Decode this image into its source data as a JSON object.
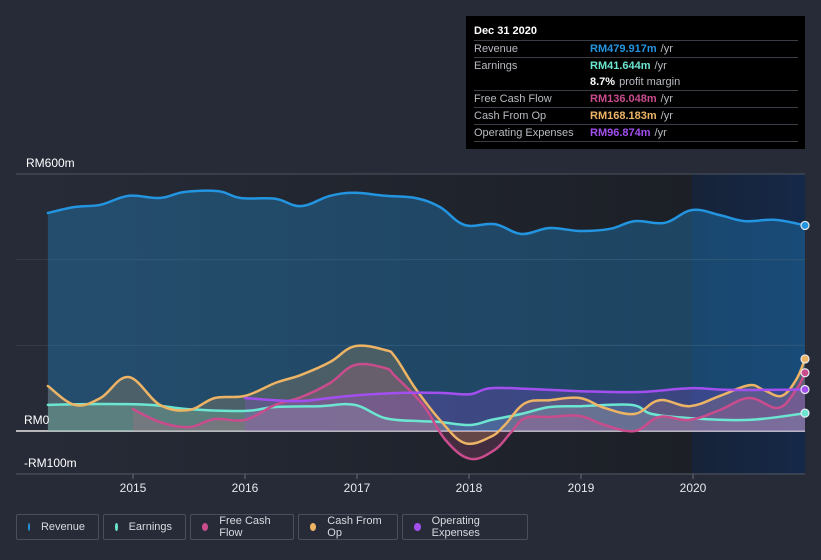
{
  "tooltip": {
    "date": "Dec 31 2020",
    "rows": [
      {
        "label": "Revenue",
        "value": "RM479.917m",
        "unit": "/yr",
        "color": "#2394df"
      },
      {
        "label": "Earnings",
        "value": "RM41.644m",
        "unit": "/yr",
        "color": "#6ce5d1"
      },
      {
        "label": "",
        "value": "8.7%",
        "unit": "profit margin",
        "color": "#ffffff"
      },
      {
        "label": "Free Cash Flow",
        "value": "RM136.048m",
        "unit": "/yr",
        "color": "#c94c8d"
      },
      {
        "label": "Cash From Op",
        "value": "RM168.183m",
        "unit": "/yr",
        "color": "#eeb465"
      },
      {
        "label": "Operating Expenses",
        "value": "RM96.874m",
        "unit": "/yr",
        "color": "#a34ff0"
      }
    ]
  },
  "legend": [
    {
      "label": "Revenue",
      "color": "#2394df"
    },
    {
      "label": "Earnings",
      "color": "#6ce5d1"
    },
    {
      "label": "Free Cash Flow",
      "color": "#c94c8d"
    },
    {
      "label": "Cash From Op",
      "color": "#eeb465"
    },
    {
      "label": "Operating Expenses",
      "color": "#a34ff0"
    }
  ],
  "chart_data": {
    "type": "area",
    "title": "",
    "xlabel": "",
    "ylabel": "",
    "ylim": [
      -100,
      600
    ],
    "xlim": [
      2014.24,
      2021.0
    ],
    "y_tick_labels": [
      {
        "value": 600,
        "label": "RM600m"
      },
      {
        "value": 0,
        "label": "RM0"
      },
      {
        "value": -100,
        "label": "-RM100m"
      }
    ],
    "y_gridlines": [
      600,
      400,
      200,
      0,
      -100
    ],
    "x_tick_labels": [
      {
        "value": 2015,
        "label": "2015"
      },
      {
        "value": 2016,
        "label": "2016"
      },
      {
        "value": 2017,
        "label": "2017"
      },
      {
        "value": 2018,
        "label": "2018"
      },
      {
        "value": 2019,
        "label": "2019"
      },
      {
        "value": 2020,
        "label": "2020"
      }
    ],
    "highlight_range": [
      2020.0,
      2021.0
    ],
    "legend_position": "bottom-left",
    "grid": true,
    "series": [
      {
        "name": "Revenue",
        "color": "#2394df",
        "points": [
          [
            2014.24,
            509
          ],
          [
            2014.48,
            523
          ],
          [
            2014.71,
            528
          ],
          [
            2014.96,
            549
          ],
          [
            2015.24,
            544
          ],
          [
            2015.46,
            558
          ],
          [
            2015.76,
            560
          ],
          [
            2015.96,
            544
          ],
          [
            2016.27,
            542
          ],
          [
            2016.5,
            525
          ],
          [
            2016.76,
            549
          ],
          [
            2016.98,
            556
          ],
          [
            2017.25,
            549
          ],
          [
            2017.52,
            544
          ],
          [
            2017.74,
            523
          ],
          [
            2017.96,
            481
          ],
          [
            2018.23,
            483
          ],
          [
            2018.47,
            460
          ],
          [
            2018.72,
            474
          ],
          [
            2018.99,
            467
          ],
          [
            2019.26,
            472
          ],
          [
            2019.48,
            490
          ],
          [
            2019.75,
            486
          ],
          [
            2019.99,
            516
          ],
          [
            2020.24,
            504
          ],
          [
            2020.46,
            490
          ],
          [
            2020.73,
            493
          ],
          [
            2021.0,
            479.917
          ]
        ]
      },
      {
        "name": "Earnings",
        "color": "#6ce5d1",
        "points": [
          [
            2014.24,
            61
          ],
          [
            2014.71,
            63
          ],
          [
            2015.15,
            61
          ],
          [
            2015.5,
            51
          ],
          [
            2016.0,
            47
          ],
          [
            2016.27,
            56
          ],
          [
            2016.67,
            58
          ],
          [
            2016.98,
            61
          ],
          [
            2017.25,
            30
          ],
          [
            2017.56,
            23
          ],
          [
            2017.74,
            21
          ],
          [
            2018.01,
            14
          ],
          [
            2018.2,
            26
          ],
          [
            2018.47,
            40
          ],
          [
            2018.72,
            56
          ],
          [
            2019.0,
            58
          ],
          [
            2019.45,
            61
          ],
          [
            2019.63,
            40
          ],
          [
            2019.97,
            30
          ],
          [
            2020.5,
            26
          ],
          [
            2021.0,
            41.644
          ]
        ]
      },
      {
        "name": "Free Cash Flow",
        "color": "#c94c8d",
        "points": [
          [
            2015.0,
            51
          ],
          [
            2015.24,
            21
          ],
          [
            2015.5,
            9
          ],
          [
            2015.73,
            28
          ],
          [
            2016.0,
            26
          ],
          [
            2016.27,
            61
          ],
          [
            2016.5,
            79
          ],
          [
            2016.76,
            112
          ],
          [
            2016.98,
            154
          ],
          [
            2017.25,
            147
          ],
          [
            2017.34,
            128
          ],
          [
            2017.59,
            61
          ],
          [
            2017.79,
            -21
          ],
          [
            2018.01,
            -65
          ],
          [
            2018.23,
            -44
          ],
          [
            2018.37,
            -5
          ],
          [
            2018.5,
            30
          ],
          [
            2018.72,
            33
          ],
          [
            2018.99,
            35
          ],
          [
            2019.21,
            14
          ],
          [
            2019.48,
            0
          ],
          [
            2019.7,
            33
          ],
          [
            2019.97,
            26
          ],
          [
            2020.24,
            49
          ],
          [
            2020.5,
            77
          ],
          [
            2020.76,
            54
          ],
          [
            2020.92,
            96
          ],
          [
            2021.0,
            136.048
          ]
        ]
      },
      {
        "name": "Cash From Op",
        "color": "#eeb465",
        "points": [
          [
            2014.24,
            105
          ],
          [
            2014.48,
            61
          ],
          [
            2014.71,
            77
          ],
          [
            2014.96,
            126
          ],
          [
            2015.24,
            61
          ],
          [
            2015.5,
            49
          ],
          [
            2015.73,
            77
          ],
          [
            2016.0,
            82
          ],
          [
            2016.27,
            112
          ],
          [
            2016.5,
            131
          ],
          [
            2016.76,
            161
          ],
          [
            2016.98,
            198
          ],
          [
            2017.25,
            189
          ],
          [
            2017.34,
            173
          ],
          [
            2017.52,
            100
          ],
          [
            2017.74,
            26
          ],
          [
            2017.96,
            -28
          ],
          [
            2018.19,
            -14
          ],
          [
            2018.32,
            14
          ],
          [
            2018.5,
            65
          ],
          [
            2018.72,
            72
          ],
          [
            2018.99,
            77
          ],
          [
            2019.21,
            54
          ],
          [
            2019.48,
            40
          ],
          [
            2019.7,
            72
          ],
          [
            2019.97,
            58
          ],
          [
            2020.24,
            82
          ],
          [
            2020.5,
            107
          ],
          [
            2020.63,
            96
          ],
          [
            2020.79,
            82
          ],
          [
            2020.92,
            119
          ],
          [
            2021.0,
            168.183
          ]
        ]
      },
      {
        "name": "Operating Expenses",
        "color": "#a34ff0",
        "points": [
          [
            2016.0,
            77
          ],
          [
            2016.27,
            72
          ],
          [
            2016.5,
            70
          ],
          [
            2016.76,
            77
          ],
          [
            2017.03,
            84
          ],
          [
            2017.39,
            89
          ],
          [
            2017.74,
            89
          ],
          [
            2018.01,
            86
          ],
          [
            2018.19,
            100
          ],
          [
            2018.55,
            98
          ],
          [
            2018.99,
            93
          ],
          [
            2019.52,
            91
          ],
          [
            2019.97,
            100
          ],
          [
            2020.33,
            96
          ],
          [
            2021.0,
            96.874
          ]
        ]
      }
    ]
  }
}
